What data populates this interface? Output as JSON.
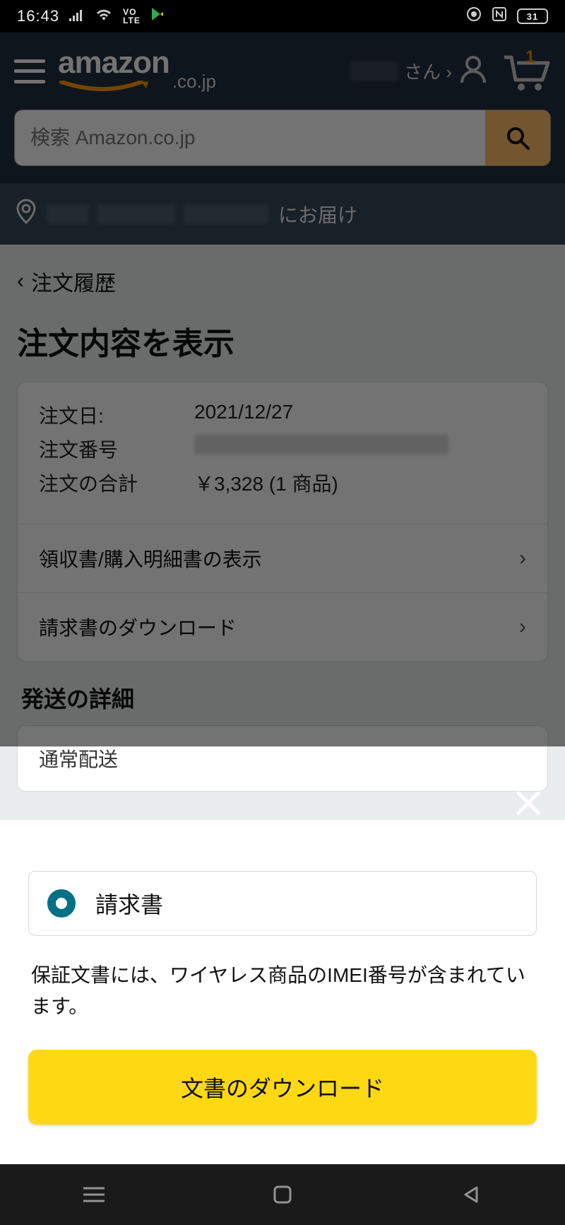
{
  "status": {
    "time": "16:43",
    "volte": "VO\nLTE",
    "battery": "31"
  },
  "header": {
    "brand": "amazon",
    "domain_suffix": ".co.jp",
    "greet_suffix": "さん ›",
    "cart_count": "1"
  },
  "search": {
    "placeholder": "検索 Amazon.co.jp"
  },
  "deliver": {
    "suffix": "にお届け"
  },
  "page": {
    "back": "注文履歴",
    "title": "注文内容を表示",
    "order": {
      "date_label": "注文日:",
      "date_value": "2021/12/27",
      "number_label": "注文番号",
      "total_label": "注文の合計",
      "total_value": "￥3,328 (1 商品)"
    },
    "links": {
      "receipt": "領収書/購入明細書の表示",
      "invoice": "請求書のダウンロード"
    },
    "ship_title": "発送の詳細",
    "ship_method": "通常配送"
  },
  "sheet": {
    "option": "請求書",
    "note": "保証文書には、ワイヤレス商品のIMEI番号が含まれています。",
    "button": "文書のダウンロード"
  }
}
